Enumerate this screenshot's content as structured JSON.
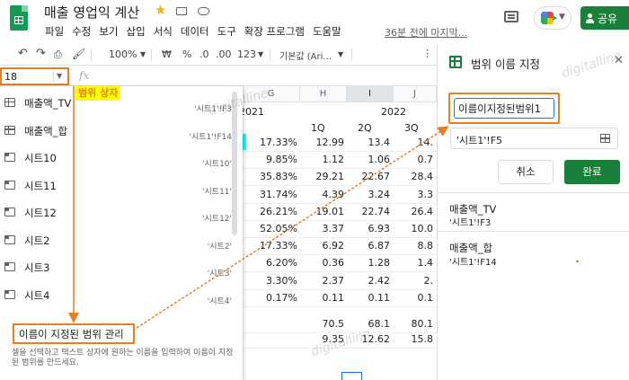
{
  "title": "매출 영업익 계산",
  "menu": [
    "파일",
    "수정",
    "보기",
    "삽입",
    "서식",
    "데이터",
    "도구",
    "확장 프로그램",
    "도움말"
  ],
  "last_edit": "36분 전에 마지막...",
  "share_label": "공유",
  "toolbar": {
    "zoom": "100%",
    "currency": "₩",
    "percent": "%",
    "dec_decrease": ".0",
    "dec_increase": ".00",
    "number_format": "123",
    "font": "기본값 (Ari..."
  },
  "namebox_value": "18",
  "fx": "fx",
  "callout_label": "범위 상자",
  "dropdown": {
    "items": [
      {
        "icon": "range",
        "label": "매출액_TV",
        "ref": "'시트1'!F3"
      },
      {
        "icon": "range",
        "label": "매출액_합",
        "ref": "'시트1'!F14"
      },
      {
        "icon": "sheet",
        "label": "시트10",
        "ref": "'시트10'"
      },
      {
        "icon": "sheet",
        "label": "시트11",
        "ref": "'시트11'"
      },
      {
        "icon": "sheet",
        "label": "시트12",
        "ref": "'시트12'"
      },
      {
        "icon": "sheet",
        "label": "시트2",
        "ref": "'시트2'"
      },
      {
        "icon": "sheet",
        "label": "시트3",
        "ref": "'시트3'"
      },
      {
        "icon": "sheet",
        "label": "시트4",
        "ref": "'시트4'"
      }
    ],
    "manage_label": "이름이 지정된 범위 관리",
    "help_text": "셀을 선택하고 텍스트 상자에 원하는 이름을 입력하여 이름이 지정된 범위를 만드세요."
  },
  "grid": {
    "columns": [
      "G",
      "H",
      "I",
      "J"
    ],
    "year_left": "2021",
    "year_right": "2022",
    "quarters": [
      "1Q",
      "2Q",
      "3Q"
    ],
    "rows": [
      [
        "17.33%",
        "12.99",
        "13.4",
        "14."
      ],
      [
        "9.85%",
        "1.12",
        "1.06",
        "0.7"
      ],
      [
        "35.83%",
        "29.21",
        "22.67",
        "28.4"
      ],
      [
        "31.74%",
        "4.39",
        "3.24",
        "3.3"
      ],
      [
        "26.21%",
        "19.01",
        "22.74",
        "26.4"
      ],
      [
        "52.05%",
        "3.37",
        "6.93",
        "10.0"
      ],
      [
        "17.33%",
        "6.92",
        "6.87",
        "8.8"
      ],
      [
        "6.20%",
        "0.36",
        "1.28",
        "1.4"
      ],
      [
        "3.30%",
        "2.37",
        "2.42",
        "2."
      ],
      [
        "0.17%",
        "0.11",
        "0.11",
        "0.1"
      ]
    ],
    "total_rows": [
      [
        "",
        "70.5",
        "68.1",
        "80.1"
      ],
      [
        "",
        "9.35",
        "12.62",
        "15.8"
      ]
    ]
  },
  "panel": {
    "title": "범위 이름 지정",
    "name_value": "이름이지정된범위1",
    "range_value": "'시트1'!F5",
    "cancel_label": "취소",
    "done_label": "완료",
    "named_ranges": [
      {
        "name": "매출액_TV",
        "ref": "'시트1'!F3"
      },
      {
        "name": "매출액_합",
        "ref": "'시트1'!F14"
      }
    ]
  },
  "watermark": "digitalline",
  "colors": {
    "accent_orange": "#e67e22",
    "sheets_green": "#188038",
    "callout_yellow": "#ffff00"
  }
}
